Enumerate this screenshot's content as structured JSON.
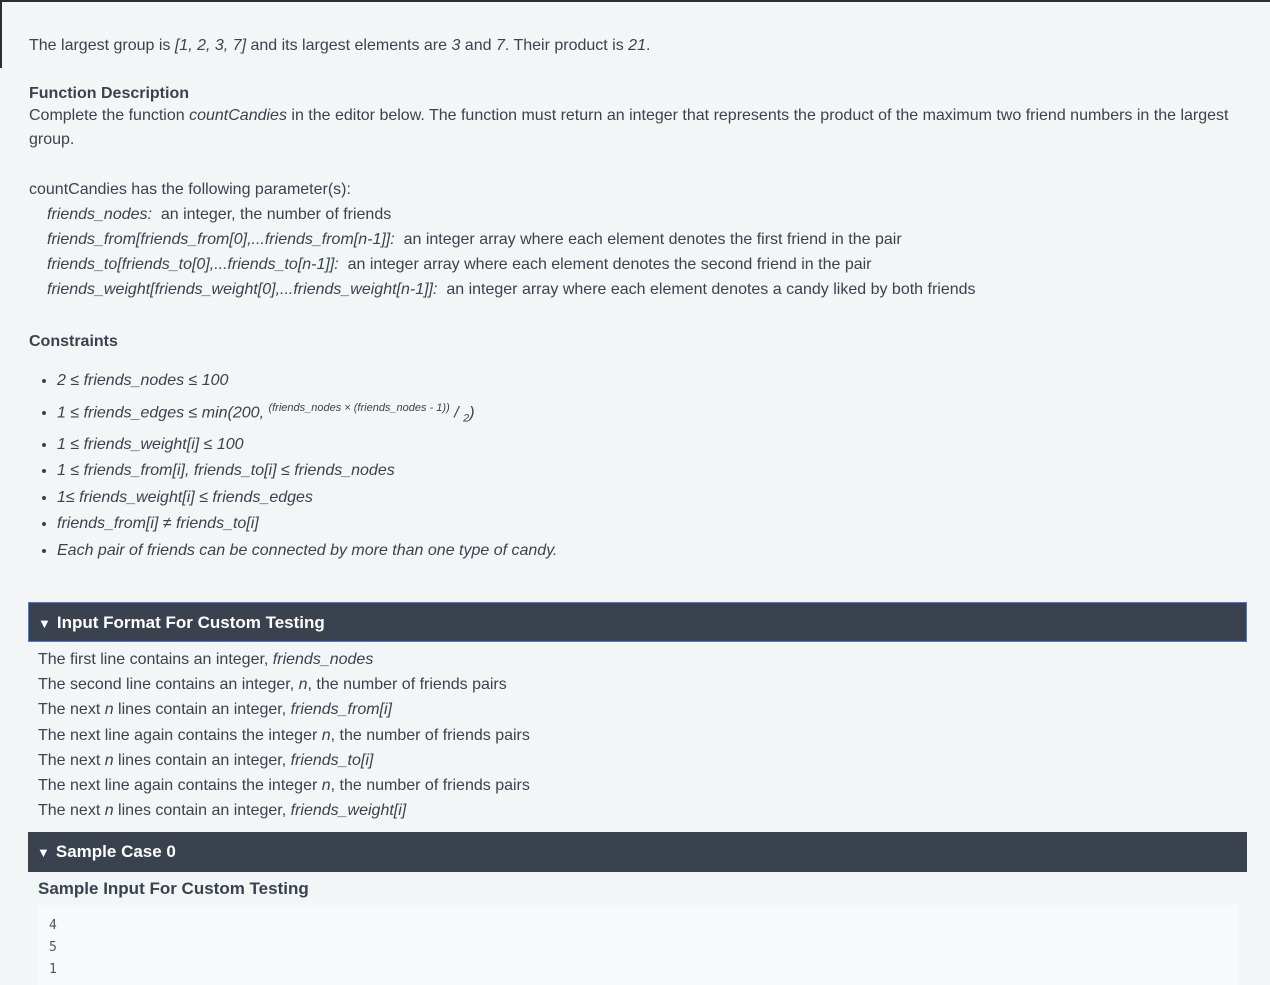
{
  "intro": {
    "a": "The largest group is ",
    "group": "[1, 2, 3, 7]",
    "b": " and its largest elements are ",
    "x": "3",
    "c": " and ",
    "y": "7",
    "d": ". Their product is ",
    "prod": "21",
    "e": "."
  },
  "function_description": {
    "heading": "Function Description",
    "a": "Complete the function ",
    "fn": "countCandies",
    "b": " in the editor below. The function must return an integer that represents the product of the maximum two friend numbers in the largest group."
  },
  "parameters": {
    "intro": "countCandies has the following parameter(s):",
    "items": [
      {
        "name": "friends_nodes:",
        "desc": "an integer, the number of friends"
      },
      {
        "name": "friends_from[friends_from[0],...friends_from[n-1]]:",
        "desc": "an integer array where each element denotes the first friend in the pair"
      },
      {
        "name": "friends_to[friends_to[0],...friends_to[n-1]]:",
        "desc": "an integer array where each element denotes the second friend in the pair"
      },
      {
        "name": "friends_weight[friends_weight[0],...friends_weight[n-1]]:",
        "desc": "an integer array where each element denotes a candy liked by both friends"
      }
    ]
  },
  "constraints": {
    "heading": "Constraints",
    "items": [
      "2 ≤ friends_nodes ≤ 100",
      {
        "a": "1 ≤ friends_edges ≤ min(200, ",
        "sup": "(friends_nodes × (friends_nodes - 1))",
        "slash": " / ",
        "sub": "2",
        "end": ")"
      },
      "1 ≤ friends_weight[i] ≤ 100",
      "1 ≤ friends_from[i], friends_to[i] ≤ friends_nodes",
      "1≤ friends_weight[i] ≤ friends_edges",
      "friends_from[i] ≠ friends_to[i]",
      "Each pair of friends can be connected by more than one type of candy."
    ]
  },
  "input_format": {
    "title": "Input Format For Custom Testing",
    "toggle_icon": "triangle-down",
    "lines": [
      {
        "a": "The first line contains an integer, ",
        "i": "friends_nodes",
        "b": ""
      },
      {
        "a": "The second line contains an integer, ",
        "i": "n",
        "b": ", the number of friends pairs"
      },
      {
        "a": "The next ",
        "i": "n",
        "b": " lines contain an integer, ",
        "i2": "friends_from[i]"
      },
      {
        "a": "The next line again contains the integer ",
        "i": "n",
        "b": ", the number of friends pairs"
      },
      {
        "a": "The next ",
        "i": "n",
        "b": " lines contain an integer, ",
        "i2": "friends_to[i]"
      },
      {
        "a": "The next line again contains the integer ",
        "i": "n",
        "b": ", the number of friends pairs"
      },
      {
        "a": "The next ",
        "i": "n",
        "b": " lines contain an integer, ",
        "i2": "friends_weight[i]"
      }
    ]
  },
  "sample_case": {
    "title": "Sample Case 0",
    "input_heading": "Sample Input For Custom Testing",
    "input_lines": [
      "4",
      "5",
      "1"
    ]
  }
}
